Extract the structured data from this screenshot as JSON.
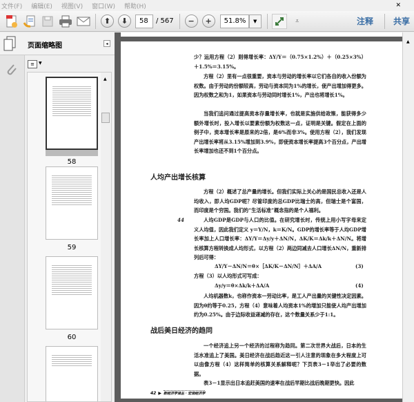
{
  "menu": [
    "文件(F)",
    "编辑(E)",
    "视图(V)",
    "窗口(W)",
    "帮助(H)"
  ],
  "toolbar": {
    "page_current": "58",
    "page_total": "/ 567",
    "zoom": "51.8%",
    "annotate": "注释",
    "share": "共享"
  },
  "sidebar": {
    "title": "页面缩略图",
    "thumbnails": [
      {
        "label": "58"
      },
      {
        "label": "59"
      },
      {
        "label": "60"
      }
    ]
  },
  "document": {
    "p1": "少？运用方程（2）则得增长率：ΔY/Y＝（0.75×1.2%）＋（0.25×3%）＋1.5%＝3.15%。",
    "p2": "方程（2）里有一点很重要，资本与劳动的增长率以它们各自的收入份额为权数。由于劳动的份额较高，劳动与资本同为1%的增长，使产出增加得更多。因为权数之和为1，如果资本与劳动同时增长1%，产出也将增长1%。",
    "p3": "当我们追问通过提高资本存量增长率，也就是实施供给政策，能获得多少额外增长时，投入增长以要素份额为权数这一点，证明是关键。假定在上面的例子中，资本增长率是原来的2倍，是6%而非3%。使用方程（2），我们发现产出增长率将从3.15%增加到3.9%，即使资本增长率提高3个百分点，产出增长率增加也还不到1个百分点。",
    "h1": "人均产出增长核算",
    "p4": "方程（2）概述了总产量的增长。但我们实际上关心的是国民总收入还是人均收入，即人均GDP呢？尽管印度的总GDP比瑞士的高，但瑞士是个富国，而印度是个穷国。我们的“生活标准”概念指的是个人福利。",
    "margin_num": "44",
    "p5": "人均GDP是GDP与人口的比值。在研究增长时，传统上用小写字母来定义人均值，因此我们定义 y＝Y/N，k＝K/N。GDP的增长率等于人均GDP增长率加上人口增长率：ΔY/Y＝Δy/y＋ΔN/N，ΔK/K＝Δk/k＋ΔN/N。将增长核算方程转换成人均形式，以方程（2）两边同减去人口增长ΔN/N，重新排列后可得：",
    "eq3": "ΔY/Y－ΔN/N＝θ×［ΔK/K－ΔN/N］＋ΔA/A",
    "eq3_num": "(3)",
    "p6": "方程（3）以人均形式可写成：",
    "eq4": "Δy/y＝θ×Δk/k＋ΔA/A",
    "eq4_num": "(4)",
    "p7": "人均机器数k，也称作资本一劳动比率，是工人产出量的关键性决定因素。因为θ约等于0.25，方程（4）意味着人均资本1%的增加只能使人均产出增加约为0.25%。由于边际收益递减的存在，这个数量关系少于1:1。",
    "h2": "战后美日经济的趋同",
    "p8": "一个经济追上另一个经济的过程称为趋同。第二次世界大战后，日本的生活水准追上了美国。美日经济在战后趋近这一引人注意的现象在多大程度上可以由像方程（4）这样简单的核算关系解释呢？下页表3－1举出了必要的数据。",
    "p9": "表3－1显示出日本追赶美国的速率在战后早期比战后晚期更快。因此",
    "footer_page": "42",
    "footer_title": "新经济学译丛 · 宏观经济学"
  }
}
